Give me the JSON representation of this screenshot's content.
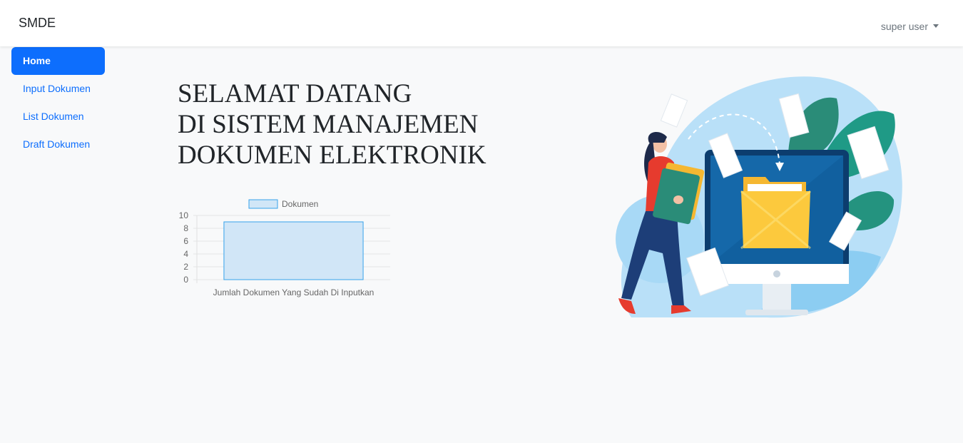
{
  "navbar": {
    "brand": "SMDE",
    "user": "super user"
  },
  "sidebar": {
    "items": [
      {
        "label": "Home",
        "active": true
      },
      {
        "label": "Input Dokumen",
        "active": false
      },
      {
        "label": "List Dokumen",
        "active": false
      },
      {
        "label": "Draft Dokumen",
        "active": false
      }
    ]
  },
  "main": {
    "welcome_lines": [
      "SELAMAT DATANG",
      "DI SISTEM MANAJEMEN",
      "DOKUMEN ELEKTRONIK"
    ]
  },
  "colors": {
    "primary": "#0d6efd",
    "bar_fill": "#d1e6f7",
    "bar_border": "#36a2eb"
  },
  "chart_data": {
    "type": "bar",
    "categories": [
      "Jumlah Dokumen Yang Sudah Di Inputkan"
    ],
    "series": [
      {
        "name": "Dokumen",
        "values": [
          9
        ]
      }
    ],
    "ylim": [
      0,
      10
    ],
    "yticks": [
      0,
      2,
      4,
      6,
      8,
      10
    ],
    "legend": "top",
    "grid": true
  }
}
